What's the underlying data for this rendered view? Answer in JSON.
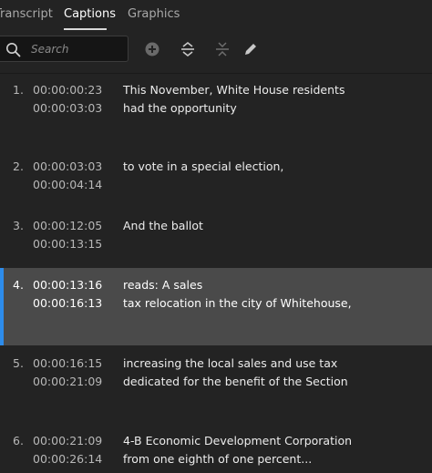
{
  "tabs": [
    {
      "label": "Transcript"
    },
    {
      "label": "Captions"
    },
    {
      "label": "Graphics"
    }
  ],
  "search": {
    "placeholder": "Search",
    "value": ""
  },
  "toolbar_icons": [
    "add-icon",
    "split-icon",
    "merge-icon",
    "edit-icon"
  ],
  "accent_color": "#2d8ceb",
  "captions": [
    {
      "num": "1.",
      "start": "00:00:00:23",
      "end": "00:00:03:03",
      "line1": "This November, White House residents",
      "line2": "had the opportunity"
    },
    {
      "num": "2.",
      "start": "00:00:03:03",
      "end": "00:00:04:14",
      "line1": "to vote in a special election,",
      "line2": ""
    },
    {
      "num": "3.",
      "start": "00:00:12:05",
      "end": "00:00:13:15",
      "line1": "And the ballot",
      "line2": ""
    },
    {
      "num": "4.",
      "start": "00:00:13:16",
      "end": "00:00:16:13",
      "line1": "reads: A sales",
      "line2": "tax relocation in the city of Whitehouse,"
    },
    {
      "num": "5.",
      "start": "00:00:16:15",
      "end": "00:00:21:09",
      "line1": "increasing the local sales and use tax",
      "line2": "dedicated for the benefit of the Section"
    },
    {
      "num": "6.",
      "start": "00:00:21:09",
      "end": "00:00:26:14",
      "line1": "4-B Economic Development Corporation",
      "line2": "from one eighth of one percent..."
    }
  ]
}
